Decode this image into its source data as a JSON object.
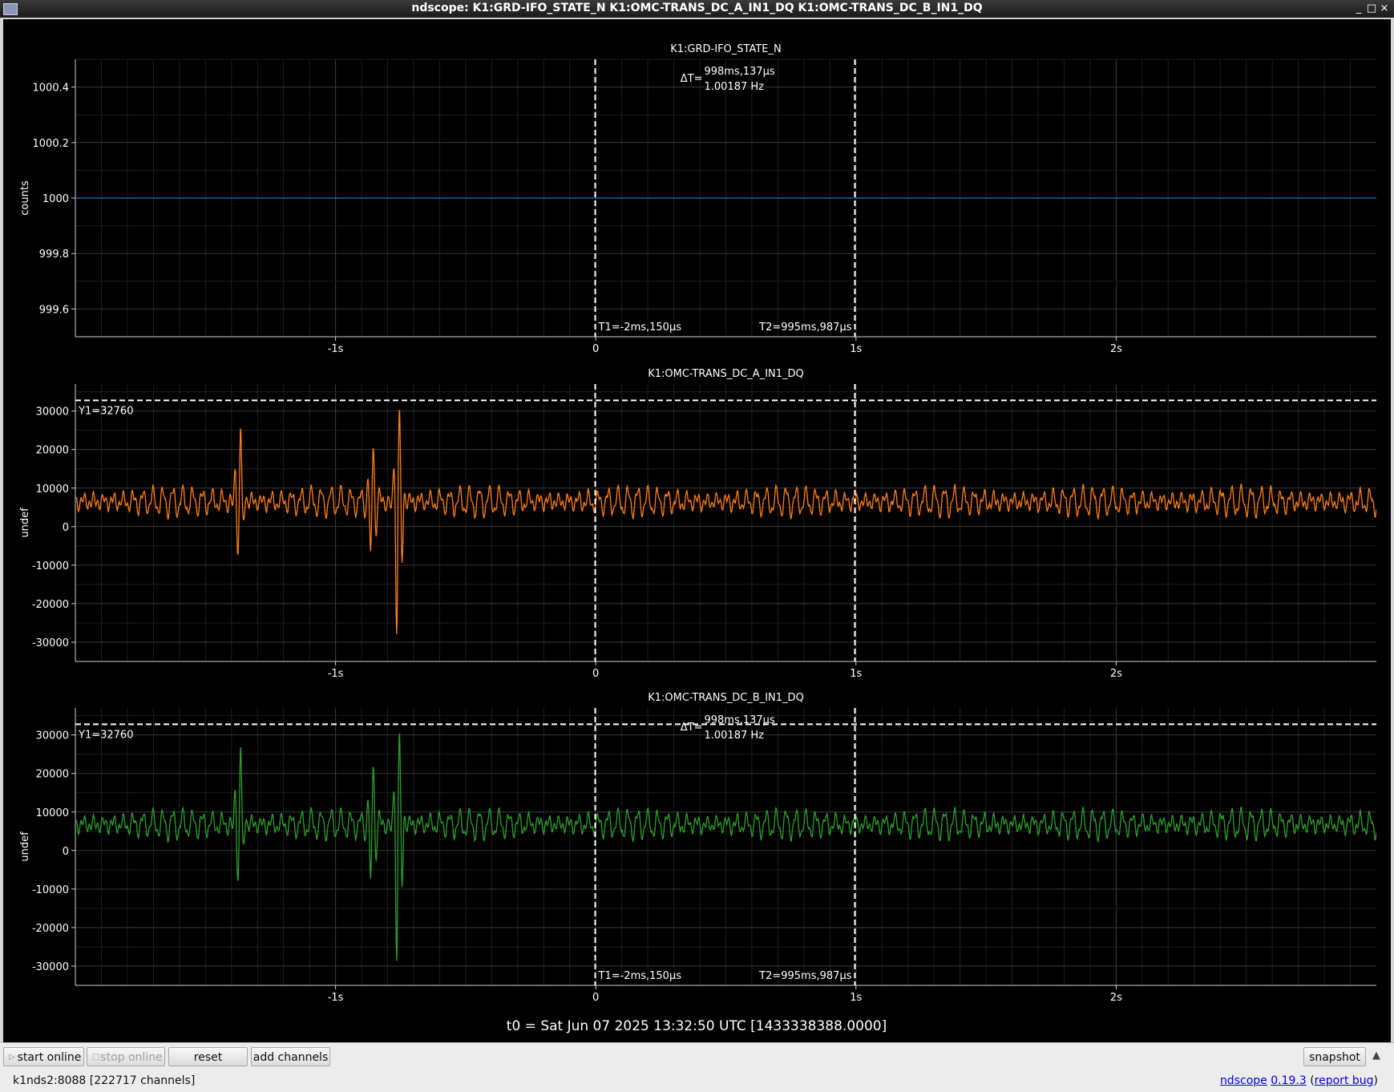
{
  "window": {
    "title": "ndscope: K1:GRD-IFO_STATE_N K1:OMC-TRANS_DC_A_IN1_DQ K1:OMC-TRANS_DC_B_IN1_DQ",
    "controls": [
      "_",
      "□",
      "×"
    ]
  },
  "colors": {
    "background": "#000000",
    "state": "#1f77b4",
    "dc_a": "#ff7f0e",
    "dc_b": "#2ca02c",
    "cursor": "#ffffff",
    "grid": "#2a2a2a"
  },
  "xaxis": {
    "ticks": [
      -1,
      0,
      1,
      2
    ],
    "tick_labels": [
      "-1s",
      "0",
      "1s",
      "2s"
    ],
    "range": [
      -2.0,
      3.0
    ]
  },
  "cursors": {
    "t1_label": "T1=-2ms,150µs",
    "t2_label": "T2=995ms,987µs",
    "t1": -0.00215,
    "t2": 0.995987,
    "dt_prefix": "ΔT=",
    "dt_value": "998ms,137µs",
    "dt_freq": "1.00187 Hz",
    "y1_label": "Y1=32760",
    "y1": 32760
  },
  "panels": [
    {
      "title": "K1:GRD-IFO_STATE_N",
      "ylabel": "counts",
      "yticks": [
        1000.4,
        1000.2,
        1000,
        999.8,
        999.6
      ],
      "ytick_labels": [
        "1000.4",
        "1000.2",
        "1000",
        "999.8",
        "999.6"
      ],
      "ylim": [
        999.5,
        1000.5
      ]
    },
    {
      "title": "K1:OMC-TRANS_DC_A_IN1_DQ",
      "ylabel": "undef",
      "yticks": [
        30000,
        20000,
        10000,
        0,
        -10000,
        -20000,
        -30000
      ],
      "ytick_labels": [
        "30000",
        "20000",
        "10000",
        "0",
        "-10000",
        "-20000",
        "-30000"
      ],
      "ylim": [
        -35000,
        37000
      ]
    },
    {
      "title": "K1:OMC-TRANS_DC_B_IN1_DQ",
      "ylabel": "undef",
      "yticks": [
        30000,
        20000,
        10000,
        0,
        -10000,
        -20000,
        -30000
      ],
      "ytick_labels": [
        "30000",
        "20000",
        "10000",
        "0",
        "-10000",
        "-20000",
        "-30000"
      ],
      "ylim": [
        -35000,
        37000
      ]
    }
  ],
  "chart_data": [
    {
      "type": "line",
      "title": "K1:GRD-IFO_STATE_N",
      "ylabel": "counts",
      "xlim": [
        -2.0,
        3.0
      ],
      "ylim": [
        999.5,
        1000.5
      ],
      "grid": true,
      "series": [
        {
          "name": "K1:GRD-IFO_STATE_N",
          "x": [
            -2.0,
            3.0
          ],
          "y": [
            1000,
            1000
          ]
        }
      ]
    },
    {
      "type": "line",
      "title": "K1:OMC-TRANS_DC_A_IN1_DQ",
      "ylabel": "undef",
      "xlim": [
        -2.0,
        3.0
      ],
      "ylim": [
        -35000,
        37000
      ],
      "grid": true,
      "series": [
        {
          "name": "K1:OMC-TRANS_DC_A_IN1_DQ",
          "baseline": 6500,
          "oscillation_amplitude": 3000,
          "glitches": [
            {
              "x": -1.37,
              "peak": 28000,
              "trough": -8500
            },
            {
              "x": -0.86,
              "peak": 23500,
              "trough": -11000
            },
            {
              "x": -0.76,
              "peak": 32700,
              "trough": -32000
            }
          ]
        }
      ]
    },
    {
      "type": "line",
      "title": "K1:OMC-TRANS_DC_B_IN1_DQ",
      "ylabel": "undef",
      "xlim": [
        -2.0,
        3.0
      ],
      "ylim": [
        -35000,
        37000
      ],
      "grid": true,
      "series": [
        {
          "name": "K1:OMC-TRANS_DC_B_IN1_DQ",
          "baseline": 6800,
          "oscillation_amplitude": 3000,
          "glitches": [
            {
              "x": -1.37,
              "peak": 29500,
              "trough": -9200
            },
            {
              "x": -0.86,
              "peak": 25000,
              "trough": -12000
            },
            {
              "x": -0.76,
              "peak": 32700,
              "trough": -32800
            }
          ]
        }
      ]
    }
  ],
  "t0_label": "t0 = Sat Jun 07 2025 13:32:50 UTC [1433338388.0000]",
  "toolbar": {
    "start_online": "start online",
    "stop_online": "stop online",
    "reset": "reset",
    "add_channels": "add channels",
    "snapshot": "snapshot",
    "collapse_arrow": "▲"
  },
  "status": {
    "server": "k1nds2:8088  [222717 channels]",
    "app": "ndscope",
    "version": "0.19.3",
    "report_prefix": "(",
    "report_bug": "report bug",
    "report_suffix": ")"
  }
}
